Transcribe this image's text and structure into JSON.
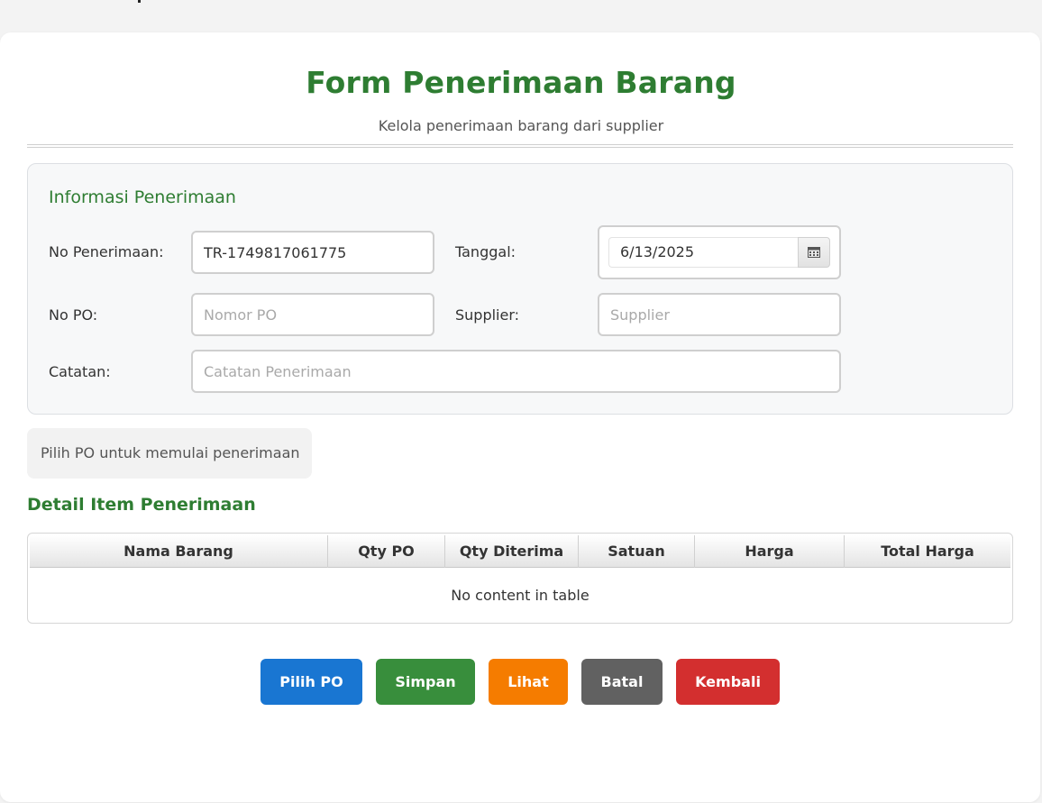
{
  "header": {
    "title": "Form Penerimaan Barang",
    "subtitle": "Kelola penerimaan barang dari supplier"
  },
  "info": {
    "section_title": "Informasi Penerimaan",
    "no_penerimaan_label": "No Penerimaan:",
    "no_penerimaan_value": "TR-1749817061775",
    "tanggal_label": "Tanggal:",
    "tanggal_value": "6/13/2025",
    "no_po_label": "No PO:",
    "no_po_placeholder": "Nomor PO",
    "supplier_label": "Supplier:",
    "supplier_placeholder": "Supplier",
    "catatan_label": "Catatan:",
    "catatan_placeholder": "Catatan Penerimaan"
  },
  "hint_text": "Pilih PO untuk memulai penerimaan",
  "detail": {
    "section_title": "Detail Item Penerimaan",
    "columns": [
      "Nama Barang",
      "Qty PO",
      "Qty Diterima",
      "Satuan",
      "Harga",
      "Total Harga"
    ],
    "empty_text": "No content in table"
  },
  "buttons": {
    "pilih_po": "Pilih PO",
    "simpan": "Simpan",
    "lihat": "Lihat",
    "batal": "Batal",
    "kembali": "Kembali"
  },
  "colors": {
    "accent_green": "#2e7d32",
    "pilih_po": "#1976d2",
    "simpan": "#388e3c",
    "lihat": "#f57c00",
    "batal": "#616161",
    "kembali": "#d32f2f"
  },
  "icons": {
    "date_picker": "calendar-icon"
  }
}
